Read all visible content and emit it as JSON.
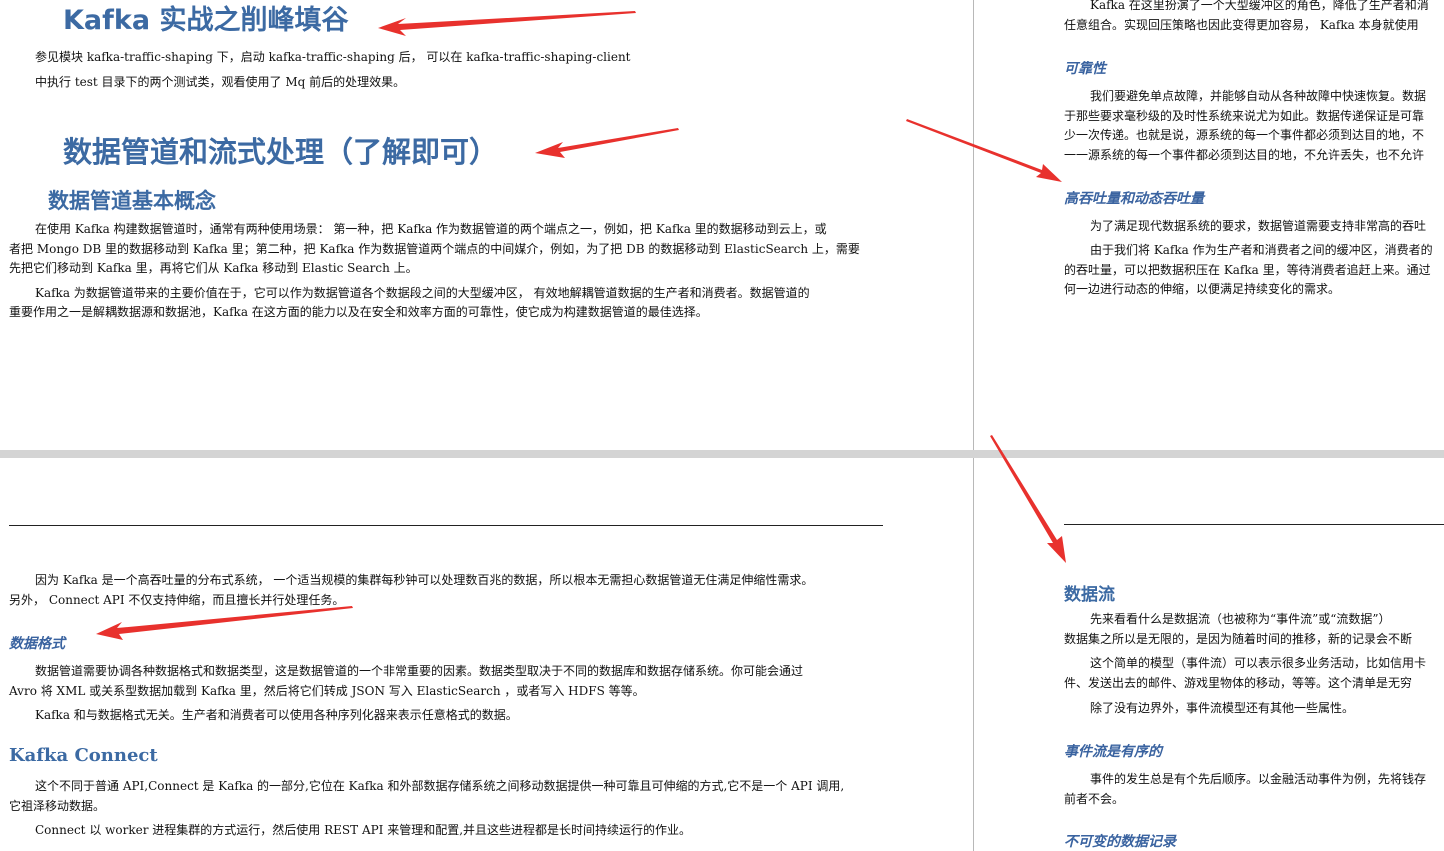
{
  "colors": {
    "heading": "#3c6aa3",
    "arrow": "#e8312d",
    "divider": "#cfcfcf"
  },
  "left_top": {
    "title1": "Kafka 实战之削峰填谷",
    "p1_line1": "参见模块 kafka-traffic-shaping 下，启动 kafka-traffic-shaping 后，  可以在 kafka-traffic-shaping-client",
    "p1_line2": "中执行 test 目录下的两个测试类，观看使用了 Mq 前后的处理效果。",
    "title2": "数据管道和流式处理（了解即可）",
    "title3": "数据管道基本概念",
    "p2_line1": "在使用 Kafka 构建数据管道时，通常有两种使用场景：  第一种，把 Kafka 作为数据管道的两个端点之一，例如，把 Kafka 里的数据移动到云上，或",
    "p2_line2": "者把 Mongo DB 里的数据移动到 Kafka 里；第二种，把 Kafka 作为数据管道两个端点的中间媒介，例如，为了把 DB 的数据移动到 ElasticSearch 上，需要",
    "p2_line3": "先把它们移动到 Kafka 里，再将它们从 Kafka 移动到 Elastic Search 上。",
    "p3_line1": "Kafka 为数据管道带来的主要价值在于，它可以作为数据管道各个数据段之间的大型缓冲区，  有效地解耦管道数据的生产者和消费者。数据管道的",
    "p3_line2": "重要作用之一是解耦数据源和数据池，Kafka 在这方面的能力以及在安全和效率方面的可靠性，使它成为构建数据管道的最佳选择。"
  },
  "right_top": {
    "line1": "Kafka 在这里扮演了一个大型缓冲区的角色，降低了生产者和消",
    "line2": "任意组合。实现回压策略也因此变得更加容易，  Kafka 本身就使用",
    "h_reliability": "可靠性",
    "r1": "我们要避免单点故障，并能够自动从各种故障中快速恢复。数据",
    "r2": "于那些要求毫秒级的及时性系统来说尤为如此。数据传递保证是可靠",
    "r3": "少一次传递。也就是说，源系统的每一个事件都必须到达目的地，不",
    "r4": "一一源系统的每一个事件都必须到达目的地，不允许丢失，也不允许",
    "h_throughput": "高吞吐量和动态吞吐量",
    "t1": "为了满足现代数据系统的要求，数据管道需要支持非常高的吞吐",
    "t2": "由于我们将 Kafka 作为生产者和消费者之间的缓冲区，消费者的",
    "t3": "的吞吐量，可以把数据积压在 Kafka 里，等待消费者追赶上来。通过",
    "t4": "何一边进行动态的伸缩，以便满足持续变化的需求。"
  },
  "left_bottom": {
    "s1_line1": "因为 Kafka 是一个高吞吐量的分布式系统，  一个适当规模的集群每秒钟可以处理数百兆的数据，所以根本无需担心数据管道无住满足伸缩性需求。",
    "s1_line2": "另外，  Connect API 不仅支持伸缩，而且擅长并行处理任务。",
    "h_format": "数据格式",
    "f1": "数据管道需要协调各种数据格式和数据类型，这是数据管道的一个非常重要的因素。数据类型取决于不同的数据库和数据存储系统。你可能会通过",
    "f2": "Avro 将 XML 或关系型数据加载到 Kafka 里，然后将它们转成 JSON 写入 ElasticSearch ，或者写入 HDFS 等等。",
    "f3": "Kafka 和与数据格式无关。生产者和消费者可以使用各种序列化器来表示任意格式的数据。",
    "h_connect": "Kafka Connect",
    "c1": "这个不同于普通 API,Connect 是 Kafka 的一部分,它位在 Kafka 和外部数据存储系统之间移动数据提供一种可靠且可伸缩的方式,它不是一个 API 调用,",
    "c2": "它祖泽移动数据。",
    "c3": "Connect 以 worker 进程集群的方式运行，然后使用 REST API 来管理和配置,并且这些进程都是长时间持续运行的作业。"
  },
  "right_bottom": {
    "h_stream": "数据流",
    "d1": "先来看看什么是数据流（也被称为“事件流”或“流数据”）",
    "d2": "数据集之所以是无限的，是因为随着时间的推移，新的记录会不断",
    "d3": "这个简单的模型（事件流）可以表示很多业务活动，比如信用卡",
    "d4": "件、发送出去的邮件、游戏里物体的移动，等等。这个清单是无穷",
    "d5": "除了没有边界外，事件流模型还有其他一些属性。",
    "h_ordered": "事件流是有序的",
    "o1": "事件的发生总是有个先后顺序。以金融活动事件为例，先将钱存",
    "o2": "前者不会。",
    "h_immutable": "不可变的数据记录"
  }
}
